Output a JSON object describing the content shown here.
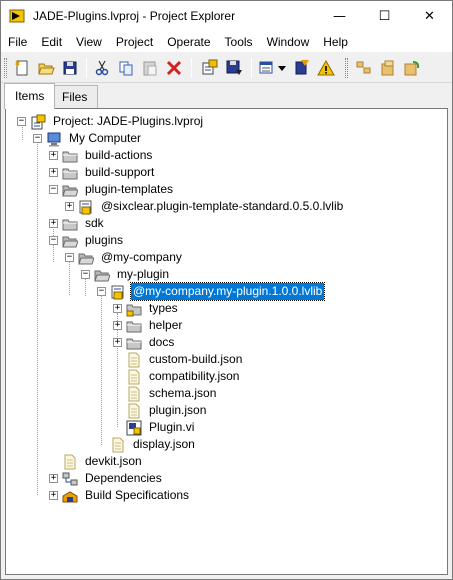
{
  "window": {
    "title": "JADE-Plugins.lvproj - Project Explorer",
    "controls": {
      "minimize": "—",
      "maximize": "☐",
      "close": "✕"
    }
  },
  "menu": {
    "items": [
      "File",
      "Edit",
      "View",
      "Project",
      "Operate",
      "Tools",
      "Window",
      "Help"
    ]
  },
  "toolbar": {
    "buttons": [
      "new-icon",
      "open-icon",
      "save-all-icon",
      "cut-icon",
      "copy-icon",
      "paste-icon",
      "delete-icon",
      "build-icon",
      "save-icon",
      "view-dropdown-icon",
      "filter-icon",
      "warning-icon",
      "sort-icon",
      "add-files-icon",
      "refresh-icon"
    ]
  },
  "tabs": {
    "items": "Items",
    "files": "Files"
  },
  "tree": {
    "project": "Project: JADE-Plugins.lvproj",
    "my_computer": "My Computer",
    "build_actions": "build-actions",
    "build_support": "build-support",
    "plugin_templates": "plugin-templates",
    "template_lib": "@sixclear.plugin-template-standard.0.5.0.lvlib",
    "sdk": "sdk",
    "plugins": "plugins",
    "my_company": "@my-company",
    "my_plugin": "my-plugin",
    "plugin_lib": "@my-company.my-plugin.1.0.0.lvlib",
    "types": "types",
    "helper": "helper",
    "docs": "docs",
    "custom_build": "custom-build.json",
    "compatibility": "compatibility.json",
    "schema": "schema.json",
    "plugin_json": "plugin.json",
    "plugin_vi": "Plugin.vi",
    "display": "display.json",
    "devkit": "devkit.json",
    "dependencies": "Dependencies",
    "build_specs": "Build Specifications"
  },
  "colors": {
    "selection": "#0078d7",
    "folder": "#a8a8a8",
    "accent": "#f5c400"
  }
}
